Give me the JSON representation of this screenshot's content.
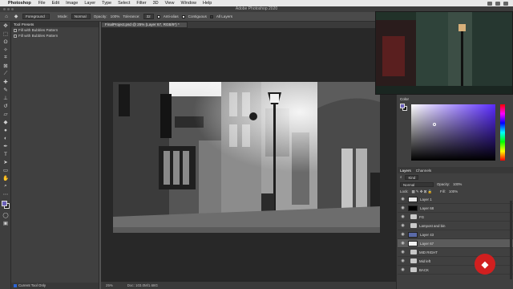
{
  "menubar": {
    "app_name": "Photoshop",
    "items": [
      "File",
      "Edit",
      "Image",
      "Layer",
      "Type",
      "Select",
      "Filter",
      "3D",
      "View",
      "Window",
      "Help"
    ]
  },
  "window": {
    "title": "Adobe Photoshop 2020"
  },
  "options": {
    "source": "Foreground",
    "mode_label": "Mode:",
    "mode_value": "Normal",
    "opacity_label": "Opacity:",
    "opacity_value": "100%",
    "tolerance_label": "Tolerance:",
    "tolerance_value": "32",
    "antialias_label": "Anti-alias",
    "contiguous_label": "Contiguous",
    "all_layers_label": "All Layers"
  },
  "tool_presets": {
    "title": "Tool Presets",
    "items": [
      "Fill with Bubbles Pattern",
      "Fill with Bubbles Pattern"
    ],
    "current_tool_only": "Current Tool Only"
  },
  "document": {
    "tab_title": "FinalProject.psd @ 25% (Layer 67, RGB/8*) *",
    "zoom": "25%",
    "doc_size": "Doc: 103.0M/1.68G"
  },
  "color_panel": {
    "title": "Color",
    "foreground": "#6a5fb8",
    "background": "#111111"
  },
  "layers_panel": {
    "tabs": [
      "Layers",
      "Channels"
    ],
    "kind_label": "Kind",
    "blend_mode": "Normal",
    "opacity_label": "Opacity:",
    "opacity_value": "100%",
    "lock_label": "Lock:",
    "fill_label": "Fill:",
    "fill_value": "100%",
    "layers": [
      {
        "name": "Layer 1",
        "type": "layer",
        "thumb": "#e8e8e8"
      },
      {
        "name": "Layer 68",
        "type": "layer",
        "thumb": "#000000"
      },
      {
        "name": "FG",
        "type": "group",
        "thumb": ""
      },
      {
        "name": "Lampost and bin",
        "type": "group",
        "thumb": ""
      },
      {
        "name": "Layer 43",
        "type": "layer",
        "thumb": "#5a6aa8"
      },
      {
        "name": "Layer 67",
        "type": "layer",
        "thumb": "#f2f2f2"
      },
      {
        "name": "MID RIGHT",
        "type": "group",
        "thumb": ""
      },
      {
        "name": "Mid left",
        "type": "group",
        "thumb": ""
      },
      {
        "name": "BACK",
        "type": "group",
        "thumb": ""
      }
    ]
  }
}
